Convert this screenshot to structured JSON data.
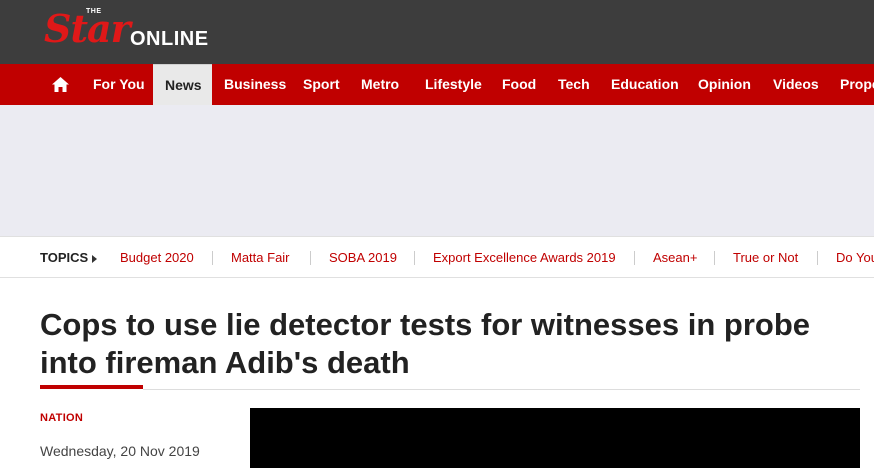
{
  "header": {
    "logo_the": "THE",
    "logo_star": "Star",
    "logo_online": "ONLINE"
  },
  "nav": {
    "home_icon": "home-icon",
    "items": [
      {
        "label": "For You"
      },
      {
        "label": "News"
      },
      {
        "label": "Business"
      },
      {
        "label": "Sport"
      },
      {
        "label": "Metro"
      },
      {
        "label": "Lifestyle"
      },
      {
        "label": "Food"
      },
      {
        "label": "Tech"
      },
      {
        "label": "Education"
      },
      {
        "label": "Opinion"
      },
      {
        "label": "Videos"
      },
      {
        "label": "Prope"
      }
    ],
    "active": "News"
  },
  "topics": {
    "label": "TOPICS",
    "items": [
      {
        "label": "Budget 2020"
      },
      {
        "label": "Matta Fair"
      },
      {
        "label": "SOBA 2019"
      },
      {
        "label": "Export Excellence Awards 2019"
      },
      {
        "label": "Asean+"
      },
      {
        "label": "True or Not"
      },
      {
        "label": "Do You"
      }
    ]
  },
  "article": {
    "headline": "Cops to use lie detector tests for witnesses in probe into fireman Adib's death",
    "section": "NATION",
    "date": "Wednesday, 20 Nov 2019"
  },
  "colors": {
    "brand_red": "#c00000",
    "header_bg": "#3d3d3d",
    "ad_bg": "#ebebf2"
  }
}
